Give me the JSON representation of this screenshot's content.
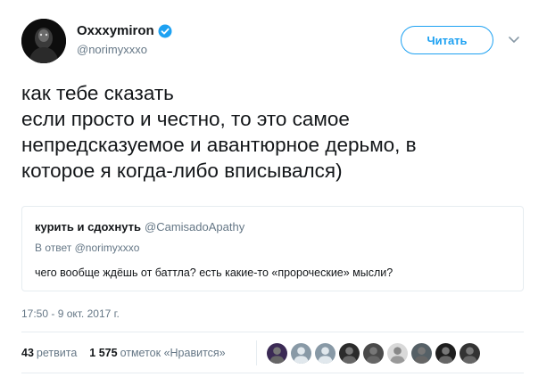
{
  "author": {
    "name": "Oxxxymiron",
    "handle": "@norimyxxxo",
    "verified": true,
    "avatar_icon": "avatar-photo-icon"
  },
  "follow_button": {
    "label": "Читать",
    "color": "#1da1f2"
  },
  "menu_icon": "chevron-down-icon",
  "tweet": {
    "lines": [
      "как тебе сказать",
      "если просто и честно, то это самое",
      "непредсказуемое и авантюрное дерьмо, в",
      "которое я когда-либо вписывался)"
    ]
  },
  "quoted_tweet": {
    "name": "курить и сдохнуть",
    "handle": "@CamisadoApathy",
    "reply_to": "В ответ @norimyxxxo",
    "text": "чего вообще ждёшь от баттла? есть какие-то «пророческие» мысли?"
  },
  "timestamp": "17:50 - 9 окт. 2017 г.",
  "stats": {
    "retweets_count": "43",
    "retweets_label": "ретвита",
    "likes_count": "1 575",
    "likes_label": "отметок «Нравится»"
  },
  "likers": [
    {
      "icon": "avatar-purple-icon",
      "color": "#3b2a55"
    },
    {
      "icon": "avatar-default-icon",
      "color": "#8899a6"
    },
    {
      "icon": "avatar-default-icon",
      "color": "#8899a6"
    },
    {
      "icon": "avatar-dark-icon",
      "color": "#2b2b2b"
    },
    {
      "icon": "avatar-face-icon",
      "color": "#4a4a4a"
    },
    {
      "icon": "avatar-sketch-icon",
      "color": "#d9d9d9"
    },
    {
      "icon": "avatar-grey-icon",
      "color": "#556066"
    },
    {
      "icon": "avatar-figure-icon",
      "color": "#1e1e1e"
    },
    {
      "icon": "avatar-black-icon",
      "color": "#333333"
    }
  ]
}
